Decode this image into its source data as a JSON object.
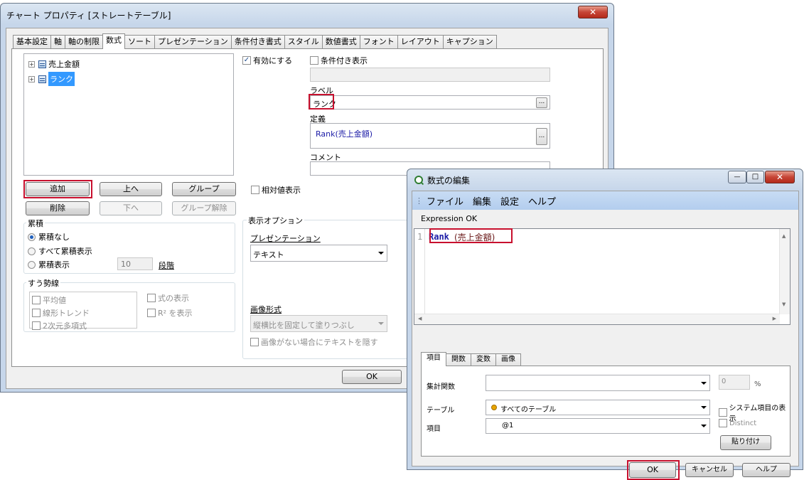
{
  "props_window": {
    "title": "チャート プロパティ [ストレートテーブル]",
    "close_glyph": "✕",
    "tabs": [
      "基本設定",
      "軸",
      "軸の制限",
      "数式",
      "ソート",
      "プレゼンテーション",
      "条件付き書式",
      "スタイル",
      "数値書式",
      "フォント",
      "レイアウト",
      "キャプション"
    ],
    "active_tab": "数式",
    "tree": [
      {
        "label": "売上金額",
        "selected": false
      },
      {
        "label": "ランク",
        "selected": true
      }
    ],
    "buttons": {
      "add": "追加",
      "up": "上へ",
      "group": "グループ",
      "delete": "削除",
      "down": "下へ",
      "ungroup": "グループ解除"
    },
    "accumulation": {
      "title": "累積",
      "options": [
        "累積なし",
        "すべて累積表示",
        "累積表示"
      ],
      "selected_index": 0,
      "steps_value": "10",
      "steps_label": "段階"
    },
    "trendlines": {
      "title": "すう勢線",
      "items": [
        "平均値",
        "線形トレンド",
        "2次元多項式"
      ],
      "show_formula": "式の表示",
      "show_r2": "R² を表示"
    },
    "enable_label": "有効にする",
    "enabled": true,
    "conditional_label": "条件付き表示",
    "label_caption": "ラベル",
    "label_value": "ランク",
    "definition_caption": "定義",
    "definition_value": "Rank(売上金額)",
    "comment_caption": "コメント",
    "relative_label": "相対値表示",
    "display_options": {
      "title": "表示オプション",
      "presentation_caption": "プレゼンテーション",
      "presentation_value": "テキスト",
      "image_format_caption": "画像形式",
      "image_format_value": "縦横比を固定して塗りつぶし",
      "hide_text_label": "画像がない場合にテキストを隠す"
    },
    "ok_label": "OK",
    "dots": "..."
  },
  "expr_window": {
    "title": "数式の編集",
    "menu": [
      "ファイル",
      "編集",
      "設定",
      "ヘルプ"
    ],
    "status": "Expression OK",
    "line_number": "1",
    "code_func": "Rank",
    "code_args": "(売上金額)",
    "tabs": [
      "項目",
      "関数",
      "変数",
      "画像"
    ],
    "active_tab": "項目",
    "aggregation_caption": "集計関数",
    "aggregation_value": "",
    "percent_value": "0",
    "percent_unit": "%",
    "table_caption": "テーブル",
    "table_value": "すべてのテーブル",
    "show_system_label": "システム項目の表示",
    "field_caption": "項目",
    "field_value": "@1",
    "distinct_label": "Distinct",
    "paste_label": "貼り付け",
    "ok_label": "OK",
    "cancel_label": "キャンセル",
    "help_label": "ヘルプ",
    "close_glyph": "✕",
    "min_glyph": "—",
    "max_glyph": "□"
  },
  "colors": {
    "highlight_red": "#c8102e",
    "selection_blue": "#3399ff",
    "code_blue": "#1a1aa6",
    "menubar_blue": "#b9d1f1"
  }
}
